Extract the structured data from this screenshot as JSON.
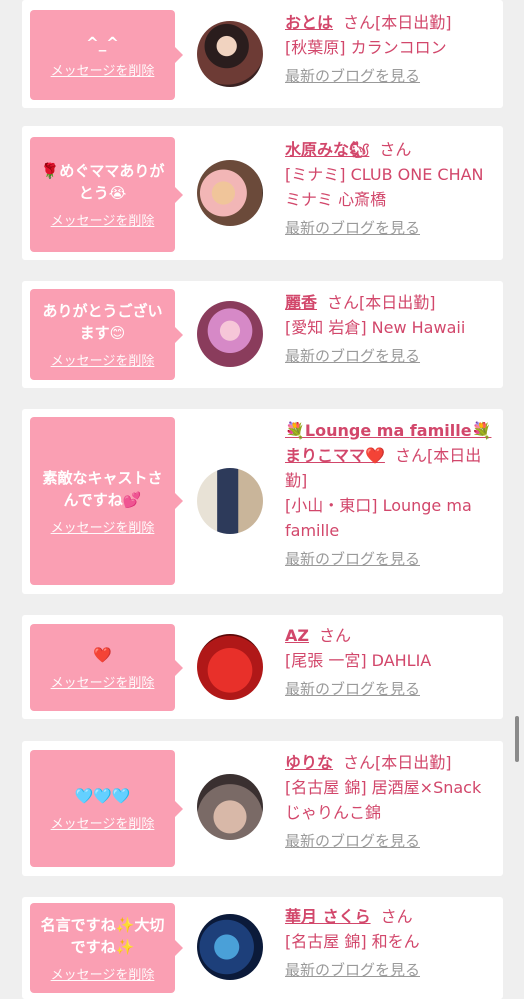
{
  "entries": [
    {
      "message": "^_^",
      "delete_label": "メッセージを削除",
      "name": "おとは",
      "san": "さん",
      "status": "[本日出勤]",
      "area_shop": "[秋葉原] カランコロン",
      "blog_label": "最新のブログを見る"
    },
    {
      "message": "🌹めぐママありがとう😭",
      "delete_label": "メッセージを削除",
      "name": "水原みな🐿",
      "san": "さん",
      "status": "",
      "area_shop": "[ミナミ] CLUB ONE CHAN ミナミ 心斎橋",
      "blog_label": "最新のブログを見る"
    },
    {
      "message": "ありがとうございます😊",
      "delete_label": "メッセージを削除",
      "name": "麗香",
      "san": "さん",
      "status": "[本日出勤]",
      "area_shop": "[愛知 岩倉] New Hawaii",
      "blog_label": "最新のブログを見る"
    },
    {
      "message": "素敵なキャストさんですね💕",
      "delete_label": "メッセージを削除",
      "name": "💐Lounge ma famille💐まりこママ❤️",
      "san": "さん",
      "status": "[本日出勤]",
      "area_shop": "[小山・東口] Lounge ma famille",
      "blog_label": "最新のブログを見る"
    },
    {
      "message": "❤️",
      "delete_label": "メッセージを削除",
      "name": "AZ",
      "san": "さん",
      "status": "",
      "area_shop": "[尾張 一宮] DAHLIA",
      "blog_label": "最新のブログを見る"
    },
    {
      "message": "🩵🩵🩵",
      "delete_label": "メッセージを削除",
      "name": "ゆりな",
      "san": "さん",
      "status": "[本日出勤]",
      "area_shop": "[名古屋 錦] 居酒屋×Snack じゃりんこ錦",
      "blog_label": "最新のブログを見る"
    },
    {
      "message": "名言ですね✨大切ですね✨",
      "delete_label": "メッセージを削除",
      "name": "華月 さくら",
      "san": "さん",
      "status": "",
      "area_shop": "[名古屋 錦] 和をん",
      "blog_label": "最新のブログを見る"
    }
  ],
  "colors": {
    "accent": "#d2476b",
    "bubble": "#fa9fb3",
    "background": "#efefef"
  }
}
